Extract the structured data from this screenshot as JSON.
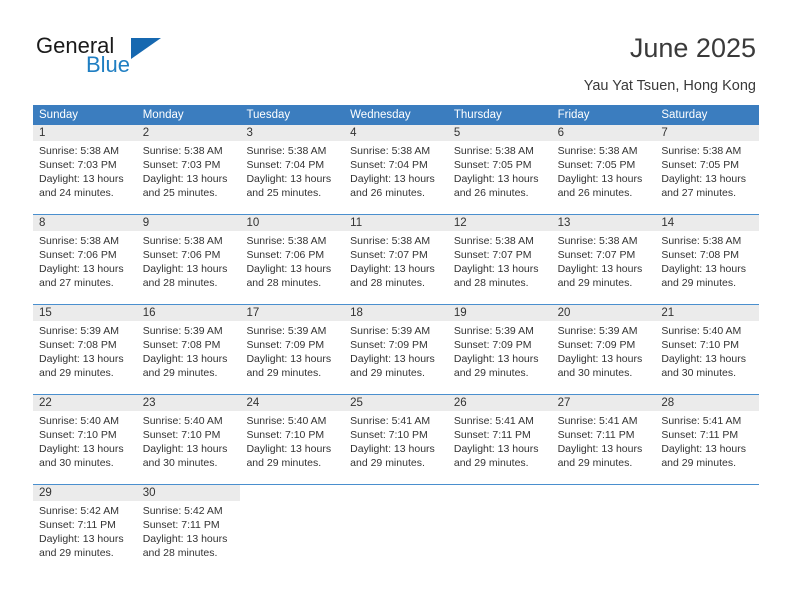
{
  "brand": {
    "word_one": "General",
    "word_two": "Blue",
    "accent_color": "#1f7ec2",
    "triangle_color": "#1668b0"
  },
  "header": {
    "title": "June 2025",
    "subtitle": "Yau Yat Tsuen, Hong Kong"
  },
  "theme": {
    "header_row_bg": "#3b7dbf",
    "header_row_text": "#ffffff",
    "daynum_band_bg": "#ebebeb",
    "week_separator": "#4a8fce",
    "body_text": "#333333"
  },
  "calendar": {
    "weekdays": [
      "Sunday",
      "Monday",
      "Tuesday",
      "Wednesday",
      "Thursday",
      "Friday",
      "Saturday"
    ],
    "weeks": [
      [
        {
          "day": "1",
          "sunrise": "Sunrise: 5:38 AM",
          "sunset": "Sunset: 7:03 PM",
          "daylight_1": "Daylight: 13 hours",
          "daylight_2": "and 24 minutes."
        },
        {
          "day": "2",
          "sunrise": "Sunrise: 5:38 AM",
          "sunset": "Sunset: 7:03 PM",
          "daylight_1": "Daylight: 13 hours",
          "daylight_2": "and 25 minutes."
        },
        {
          "day": "3",
          "sunrise": "Sunrise: 5:38 AM",
          "sunset": "Sunset: 7:04 PM",
          "daylight_1": "Daylight: 13 hours",
          "daylight_2": "and 25 minutes."
        },
        {
          "day": "4",
          "sunrise": "Sunrise: 5:38 AM",
          "sunset": "Sunset: 7:04 PM",
          "daylight_1": "Daylight: 13 hours",
          "daylight_2": "and 26 minutes."
        },
        {
          "day": "5",
          "sunrise": "Sunrise: 5:38 AM",
          "sunset": "Sunset: 7:05 PM",
          "daylight_1": "Daylight: 13 hours",
          "daylight_2": "and 26 minutes."
        },
        {
          "day": "6",
          "sunrise": "Sunrise: 5:38 AM",
          "sunset": "Sunset: 7:05 PM",
          "daylight_1": "Daylight: 13 hours",
          "daylight_2": "and 26 minutes."
        },
        {
          "day": "7",
          "sunrise": "Sunrise: 5:38 AM",
          "sunset": "Sunset: 7:05 PM",
          "daylight_1": "Daylight: 13 hours",
          "daylight_2": "and 27 minutes."
        }
      ],
      [
        {
          "day": "8",
          "sunrise": "Sunrise: 5:38 AM",
          "sunset": "Sunset: 7:06 PM",
          "daylight_1": "Daylight: 13 hours",
          "daylight_2": "and 27 minutes."
        },
        {
          "day": "9",
          "sunrise": "Sunrise: 5:38 AM",
          "sunset": "Sunset: 7:06 PM",
          "daylight_1": "Daylight: 13 hours",
          "daylight_2": "and 28 minutes."
        },
        {
          "day": "10",
          "sunrise": "Sunrise: 5:38 AM",
          "sunset": "Sunset: 7:06 PM",
          "daylight_1": "Daylight: 13 hours",
          "daylight_2": "and 28 minutes."
        },
        {
          "day": "11",
          "sunrise": "Sunrise: 5:38 AM",
          "sunset": "Sunset: 7:07 PM",
          "daylight_1": "Daylight: 13 hours",
          "daylight_2": "and 28 minutes."
        },
        {
          "day": "12",
          "sunrise": "Sunrise: 5:38 AM",
          "sunset": "Sunset: 7:07 PM",
          "daylight_1": "Daylight: 13 hours",
          "daylight_2": "and 28 minutes."
        },
        {
          "day": "13",
          "sunrise": "Sunrise: 5:38 AM",
          "sunset": "Sunset: 7:07 PM",
          "daylight_1": "Daylight: 13 hours",
          "daylight_2": "and 29 minutes."
        },
        {
          "day": "14",
          "sunrise": "Sunrise: 5:38 AM",
          "sunset": "Sunset: 7:08 PM",
          "daylight_1": "Daylight: 13 hours",
          "daylight_2": "and 29 minutes."
        }
      ],
      [
        {
          "day": "15",
          "sunrise": "Sunrise: 5:39 AM",
          "sunset": "Sunset: 7:08 PM",
          "daylight_1": "Daylight: 13 hours",
          "daylight_2": "and 29 minutes."
        },
        {
          "day": "16",
          "sunrise": "Sunrise: 5:39 AM",
          "sunset": "Sunset: 7:08 PM",
          "daylight_1": "Daylight: 13 hours",
          "daylight_2": "and 29 minutes."
        },
        {
          "day": "17",
          "sunrise": "Sunrise: 5:39 AM",
          "sunset": "Sunset: 7:09 PM",
          "daylight_1": "Daylight: 13 hours",
          "daylight_2": "and 29 minutes."
        },
        {
          "day": "18",
          "sunrise": "Sunrise: 5:39 AM",
          "sunset": "Sunset: 7:09 PM",
          "daylight_1": "Daylight: 13 hours",
          "daylight_2": "and 29 minutes."
        },
        {
          "day": "19",
          "sunrise": "Sunrise: 5:39 AM",
          "sunset": "Sunset: 7:09 PM",
          "daylight_1": "Daylight: 13 hours",
          "daylight_2": "and 29 minutes."
        },
        {
          "day": "20",
          "sunrise": "Sunrise: 5:39 AM",
          "sunset": "Sunset: 7:09 PM",
          "daylight_1": "Daylight: 13 hours",
          "daylight_2": "and 30 minutes."
        },
        {
          "day": "21",
          "sunrise": "Sunrise: 5:40 AM",
          "sunset": "Sunset: 7:10 PM",
          "daylight_1": "Daylight: 13 hours",
          "daylight_2": "and 30 minutes."
        }
      ],
      [
        {
          "day": "22",
          "sunrise": "Sunrise: 5:40 AM",
          "sunset": "Sunset: 7:10 PM",
          "daylight_1": "Daylight: 13 hours",
          "daylight_2": "and 30 minutes."
        },
        {
          "day": "23",
          "sunrise": "Sunrise: 5:40 AM",
          "sunset": "Sunset: 7:10 PM",
          "daylight_1": "Daylight: 13 hours",
          "daylight_2": "and 30 minutes."
        },
        {
          "day": "24",
          "sunrise": "Sunrise: 5:40 AM",
          "sunset": "Sunset: 7:10 PM",
          "daylight_1": "Daylight: 13 hours",
          "daylight_2": "and 29 minutes."
        },
        {
          "day": "25",
          "sunrise": "Sunrise: 5:41 AM",
          "sunset": "Sunset: 7:10 PM",
          "daylight_1": "Daylight: 13 hours",
          "daylight_2": "and 29 minutes."
        },
        {
          "day": "26",
          "sunrise": "Sunrise: 5:41 AM",
          "sunset": "Sunset: 7:11 PM",
          "daylight_1": "Daylight: 13 hours",
          "daylight_2": "and 29 minutes."
        },
        {
          "day": "27",
          "sunrise": "Sunrise: 5:41 AM",
          "sunset": "Sunset: 7:11 PM",
          "daylight_1": "Daylight: 13 hours",
          "daylight_2": "and 29 minutes."
        },
        {
          "day": "28",
          "sunrise": "Sunrise: 5:41 AM",
          "sunset": "Sunset: 7:11 PM",
          "daylight_1": "Daylight: 13 hours",
          "daylight_2": "and 29 minutes."
        }
      ],
      [
        {
          "day": "29",
          "sunrise": "Sunrise: 5:42 AM",
          "sunset": "Sunset: 7:11 PM",
          "daylight_1": "Daylight: 13 hours",
          "daylight_2": "and 29 minutes."
        },
        {
          "day": "30",
          "sunrise": "Sunrise: 5:42 AM",
          "sunset": "Sunset: 7:11 PM",
          "daylight_1": "Daylight: 13 hours",
          "daylight_2": "and 28 minutes."
        },
        {
          "day": "",
          "sunrise": "",
          "sunset": "",
          "daylight_1": "",
          "daylight_2": ""
        },
        {
          "day": "",
          "sunrise": "",
          "sunset": "",
          "daylight_1": "",
          "daylight_2": ""
        },
        {
          "day": "",
          "sunrise": "",
          "sunset": "",
          "daylight_1": "",
          "daylight_2": ""
        },
        {
          "day": "",
          "sunrise": "",
          "sunset": "",
          "daylight_1": "",
          "daylight_2": ""
        },
        {
          "day": "",
          "sunrise": "",
          "sunset": "",
          "daylight_1": "",
          "daylight_2": ""
        }
      ]
    ]
  }
}
